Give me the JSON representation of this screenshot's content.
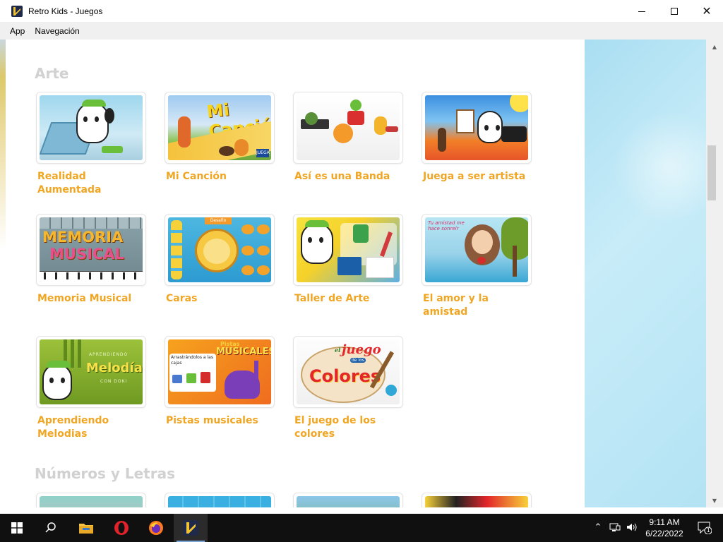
{
  "window": {
    "title": "Retro Kids - Juegos",
    "controls": {
      "minimize": "minimize",
      "maximize": "maximize",
      "close": "close"
    }
  },
  "menu": {
    "items": [
      {
        "label": "App"
      },
      {
        "label": "Navegación"
      }
    ]
  },
  "sections": [
    {
      "title": "Arte",
      "games": [
        {
          "label": "Realidad Aumentada",
          "art": "realidad-aumentada-thumbnail"
        },
        {
          "label": "Mi Canción",
          "art": "mi-cancion-thumbnail",
          "art_text": "Mi Canción",
          "badge": "JUEGA"
        },
        {
          "label": "Así es una Banda",
          "art": "banda-thumbnail"
        },
        {
          "label": "Juega a ser artista",
          "art": "artista-thumbnail"
        },
        {
          "label": "Memoria Musical",
          "art": "memoria-musical-thumbnail",
          "art_text_1": "MEMORIA",
          "art_text_2": "MUSICAL"
        },
        {
          "label": "Caras",
          "art": "caras-thumbnail",
          "art_text": "Desafio"
        },
        {
          "label": "Taller de Arte",
          "art": "taller-arte-thumbnail"
        },
        {
          "label": "El amor y la amistad",
          "art": "amor-amistad-thumbnail",
          "art_text": "Tu amistad me hace sonreír"
        },
        {
          "label": "Aprendiendo Melodias",
          "art": "melodias-thumbnail",
          "art_text_small": "APRENDIENDO",
          "art_text": "Melodías",
          "art_text_sub": "CON DOKI"
        },
        {
          "label": "Pistas musicales",
          "art": "pistas-musicales-thumbnail",
          "art_text_1": "Pistas",
          "art_text_2": "MUSICALES",
          "art_text_3": "Arrastrándolos a las cajas"
        },
        {
          "label": "El juego de los colores",
          "art": "colores-thumbnail",
          "art_text_1": "el",
          "art_text_2": "juego",
          "art_text_3": "de los",
          "art_text_4": "Colores"
        }
      ]
    },
    {
      "title": "Números y Letras",
      "games": [
        {
          "label": "",
          "art": "numeros-thumbnail-1"
        },
        {
          "label": "",
          "art": "numeros-thumbnail-2"
        },
        {
          "label": "",
          "art": "numeros-thumbnail-3"
        },
        {
          "label": "",
          "art": "numeros-thumbnail-4"
        }
      ]
    }
  ],
  "taskbar": {
    "apps": [
      {
        "name": "start",
        "icon": "windows-logo-icon"
      },
      {
        "name": "search",
        "icon": "search-icon"
      },
      {
        "name": "file-explorer",
        "icon": "folder-icon"
      },
      {
        "name": "opera",
        "icon": "opera-icon"
      },
      {
        "name": "firefox",
        "icon": "firefox-icon"
      },
      {
        "name": "retro-kids",
        "icon": "retro-kids-icon",
        "active": true
      }
    ],
    "clock": {
      "time": "9:11 AM",
      "date": "6/22/2022"
    },
    "notification_count": "1"
  },
  "colors": {
    "label_orange": "#f0a623",
    "section_gray": "#d1d1d1",
    "taskbar": "#101010"
  }
}
